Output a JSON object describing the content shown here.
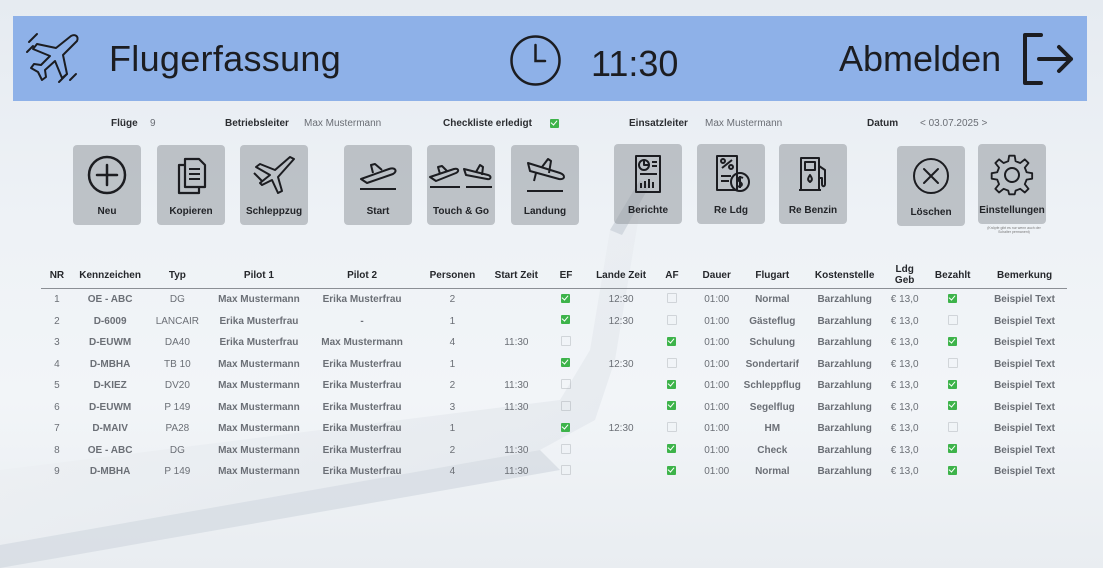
{
  "header": {
    "title": "Flugerfassung",
    "time": "11:30",
    "logout_label": "Abmelden",
    "logo_icon": "airplane-icon",
    "clock_icon": "clock-icon",
    "logout_icon": "logout-arrow-icon",
    "bg_color": "#8eb1e8"
  },
  "info": {
    "fluege_label": "Flüge",
    "fluege_value": "9",
    "betriebsleiter_label": "Betriebsleiter",
    "betriebsleiter_value": "Max Mustermann",
    "checkliste_label": "Checkliste erledigt",
    "checkliste_checked": true,
    "einsatzleiter_label": "Einsatzleiter",
    "einsatzleiter_value": "Max Mustermann",
    "datum_label": "Datum",
    "datum_value": "< 03.07.2025 >"
  },
  "toolbar": {
    "neu": "Neu",
    "kopieren": "Kopieren",
    "schleppzug": "Schleppzug",
    "start": "Start",
    "touch_go": "Touch & Go",
    "landung": "Landung",
    "berichte": "Berichte",
    "re_ldg": "Re Ldg",
    "re_benzin": "Re Benzin",
    "loeschen": "Löschen",
    "einstellungen": "Einstellungen",
    "settings_note": "(Knöpfe gibt es nur wenn auch der Schalter permanent)"
  },
  "table": {
    "columns": [
      "NR",
      "Kennzeichen",
      "Typ",
      "Pilot 1",
      "Pilot 2",
      "Personen",
      "Start Zeit",
      "EF",
      "Lande Zeit",
      "AF",
      "Dauer",
      "Flugart",
      "Kostenstelle",
      "Ldg Geb",
      "Bezahlt",
      "Bemerkung"
    ],
    "rows": [
      {
        "nr": "1",
        "kz": "OE - ABC",
        "typ": "DG",
        "p1": "Max Mustermann",
        "p2": "Erika Musterfrau",
        "pers": "2",
        "start": "",
        "ef": true,
        "lande": "12:30",
        "af": false,
        "dauer": "01:00",
        "flugart": "Normal",
        "kst": "Barzahlung",
        "ldg": "€ 13,0",
        "bezahlt": true,
        "bem": "Beispiel Text"
      },
      {
        "nr": "2",
        "kz": "D-6009",
        "typ": "LANCAIR",
        "p1": "Erika Musterfrau",
        "p2": "-",
        "pers": "1",
        "start": "",
        "ef": true,
        "lande": "12:30",
        "af": false,
        "dauer": "01:00",
        "flugart": "Gästeflug",
        "kst": "Barzahlung",
        "ldg": "€ 13,0",
        "bezahlt": false,
        "bem": "Beispiel Text"
      },
      {
        "nr": "3",
        "kz": "D-EUWM",
        "typ": "DA40",
        "p1": "Erika Musterfrau",
        "p2": "Max Mustermann",
        "pers": "4",
        "start": "11:30",
        "ef": false,
        "lande": "",
        "af": true,
        "dauer": "01:00",
        "flugart": "Schulung",
        "kst": "Barzahlung",
        "ldg": "€ 13,0",
        "bezahlt": true,
        "bem": "Beispiel Text"
      },
      {
        "nr": "4",
        "kz": "D-MBHA",
        "typ": "TB 10",
        "p1": "Max Mustermann",
        "p2": "Erika Musterfrau",
        "pers": "1",
        "start": "",
        "ef": true,
        "lande": "12:30",
        "af": false,
        "dauer": "01:00",
        "flugart": "Sondertarif",
        "kst": "Barzahlung",
        "ldg": "€ 13,0",
        "bezahlt": false,
        "bem": "Beispiel Text"
      },
      {
        "nr": "5",
        "kz": "D-KIEZ",
        "typ": "DV20",
        "p1": "Max Mustermann",
        "p2": "Erika Musterfrau",
        "pers": "2",
        "start": "11:30",
        "ef": false,
        "lande": "",
        "af": true,
        "dauer": "01:00",
        "flugart": "Schleppflug",
        "kst": "Barzahlung",
        "ldg": "€ 13,0",
        "bezahlt": true,
        "bem": "Beispiel Text"
      },
      {
        "nr": "6",
        "kz": "D-EUWM",
        "typ": "P 149",
        "p1": "Max Mustermann",
        "p2": "Erika Musterfrau",
        "pers": "3",
        "start": "11:30",
        "ef": false,
        "lande": "",
        "af": true,
        "dauer": "01:00",
        "flugart": "Segelflug",
        "kst": "Barzahlung",
        "ldg": "€ 13,0",
        "bezahlt": true,
        "bem": "Beispiel Text"
      },
      {
        "nr": "7",
        "kz": "D-MAIV",
        "typ": "PA28",
        "p1": "Max Mustermann",
        "p2": "Erika Musterfrau",
        "pers": "1",
        "start": "",
        "ef": true,
        "lande": "12:30",
        "af": false,
        "dauer": "01:00",
        "flugart": "HM",
        "kst": "Barzahlung",
        "ldg": "€ 13,0",
        "bezahlt": false,
        "bem": "Beispiel Text"
      },
      {
        "nr": "8",
        "kz": "OE - ABC",
        "typ": "DG",
        "p1": "Max Mustermann",
        "p2": "Erika Musterfrau",
        "pers": "2",
        "start": "11:30",
        "ef": false,
        "lande": "",
        "af": true,
        "dauer": "01:00",
        "flugart": "Check",
        "kst": "Barzahlung",
        "ldg": "€ 13,0",
        "bezahlt": true,
        "bem": "Beispiel Text"
      },
      {
        "nr": "9",
        "kz": "D-MBHA",
        "typ": "P 149",
        "p1": "Max Mustermann",
        "p2": "Erika Musterfrau",
        "pers": "4",
        "start": "11:30",
        "ef": false,
        "lande": "",
        "af": true,
        "dauer": "01:00",
        "flugart": "Normal",
        "kst": "Barzahlung",
        "ldg": "€ 13,0",
        "bezahlt": true,
        "bem": "Beispiel Text"
      }
    ]
  }
}
